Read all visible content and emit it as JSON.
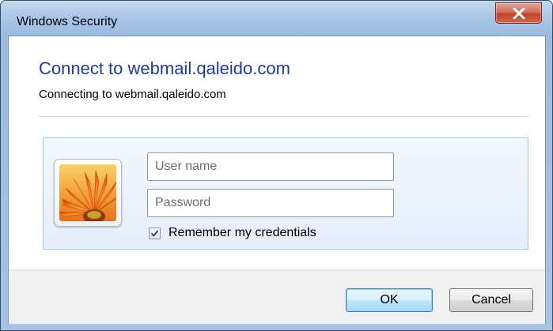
{
  "window": {
    "title": "Windows Security",
    "close_icon": "close-x-icon"
  },
  "dialog": {
    "heading": "Connect to webmail.qaleido.com",
    "subheading": "Connecting to webmail.qaleido.com"
  },
  "credentials": {
    "avatar_icon": "user-tile-flower-icon",
    "username": {
      "value": "",
      "placeholder": "User name"
    },
    "password": {
      "value": "",
      "placeholder": "Password"
    },
    "remember": {
      "label": "Remember my credentials",
      "checked": true
    }
  },
  "buttons": {
    "ok_label": "OK",
    "cancel_label": "Cancel"
  },
  "colors": {
    "heading": "#1c3ba5",
    "titlebar": "#a9c6e6",
    "close_button": "#c1412d",
    "panel_background": "#e4eefa"
  }
}
